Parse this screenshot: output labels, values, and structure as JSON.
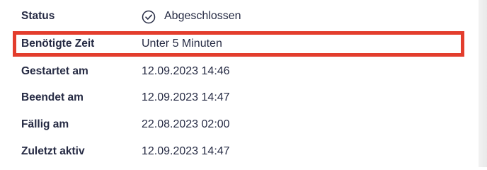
{
  "details": {
    "rows": [
      {
        "label": "Status",
        "value": "Abgeschlossen"
      },
      {
        "label": "Benötigte Zeit",
        "value": "Unter 5 Minuten"
      },
      {
        "label": "Gestartet am",
        "value": "12.09.2023 14:46"
      },
      {
        "label": "Beendet am",
        "value": "12.09.2023 14:47"
      },
      {
        "label": "Fällig am",
        "value": "22.08.2023 02:00"
      },
      {
        "label": "Zuletzt aktiv",
        "value": "12.09.2023 14:47"
      }
    ]
  },
  "colors": {
    "text": "#252a43",
    "highlight": "#e33d2d",
    "background": "#ffffff",
    "edge": "#ececec"
  },
  "icons": {
    "status": "check-circle-icon"
  }
}
